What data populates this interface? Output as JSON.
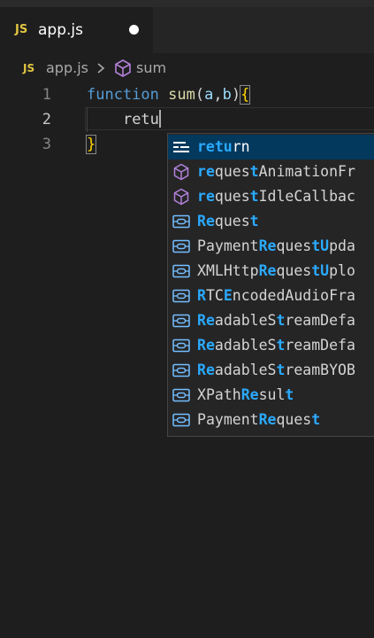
{
  "tab": {
    "lang_badge": "JS",
    "title": "app.js",
    "dirty": true
  },
  "breadcrumb": {
    "lang_badge": "JS",
    "file": "app.js",
    "symbol": "sum",
    "symbol_icon": "cube-icon"
  },
  "editor": {
    "lines": [
      {
        "number": "1",
        "text": "function sum(a,b){"
      },
      {
        "number": "2",
        "text": "    retu"
      },
      {
        "number": "3",
        "text": "}"
      }
    ],
    "line1": {
      "kw": "function",
      "fn": "sum",
      "open_paren": "(",
      "p1": "a",
      "comma": ",",
      "p2": "b",
      "close_paren": ")",
      "brace": "{"
    },
    "line2": {
      "typed": "retu"
    },
    "line3": {
      "brace": "}"
    }
  },
  "suggestions": {
    "items": [
      {
        "label": "return",
        "match": "retu",
        "rest": "rn",
        "icon": "keyword-icon",
        "selected": true
      },
      {
        "label": "requestAnimationFr",
        "icon": "method-cube-icon"
      },
      {
        "label": "requestIdleCallbac",
        "icon": "method-cube-icon"
      },
      {
        "label": "Request",
        "icon": "variable-icon"
      },
      {
        "label": "PaymentRequestUpda",
        "icon": "variable-icon"
      },
      {
        "label": "XMLHttpRequestUplo",
        "icon": "variable-icon"
      },
      {
        "label": "RTCEncodedAudioFra",
        "icon": "variable-icon"
      },
      {
        "label": "ReadableStreamDefa",
        "icon": "variable-icon"
      },
      {
        "label": "ReadableStreamDefa",
        "icon": "variable-icon"
      },
      {
        "label": "ReadableStreamBYOB",
        "icon": "variable-icon"
      },
      {
        "label": "XPathResult",
        "icon": "variable-icon"
      },
      {
        "label": "PaymentRequest",
        "icon": "variable-icon"
      }
    ]
  },
  "colors": {
    "background": "#1e1e1e",
    "keyword": "#569cd6",
    "function": "#dcdcaa",
    "parameter": "#9cdcfe",
    "brace": "#ffd700",
    "match_highlight": "#2aaaff",
    "selection": "#04395e",
    "js_badge": "#e2c541"
  }
}
